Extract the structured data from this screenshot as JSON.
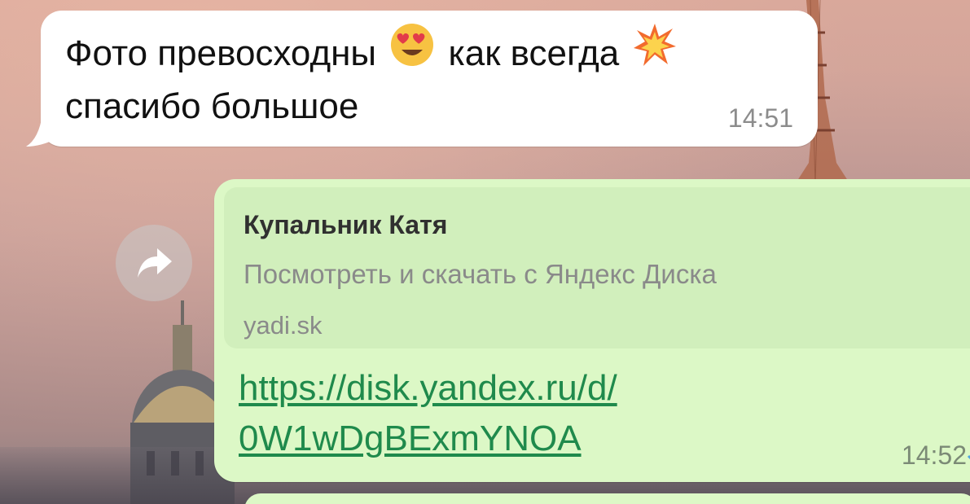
{
  "chat": {
    "incoming": {
      "line1_part1": "Фото превосходны",
      "emoji1": "smiling-face-with-heart-eyes",
      "line1_part2": "как всегда",
      "emoji2": "collision",
      "line2": "спасибо большое",
      "time": "14:51"
    },
    "outgoing": {
      "preview": {
        "title": "Купальник Катя",
        "description": "Посмотреть и скачать с Яндекс Диска",
        "domain": "yadi.sk"
      },
      "link_line1": "https://disk.yandex.ru/d/",
      "link_line2": "0W1wDgBExmYNOA",
      "time": "14:52",
      "status": "read"
    },
    "forward_icon": "forward-arrow-icon"
  },
  "colors": {
    "incoming_bubble": "#ffffff",
    "outgoing_bubble": "#dcf8c6",
    "link": "#1f8a4c",
    "read_ticks": "#4fa3e0"
  }
}
